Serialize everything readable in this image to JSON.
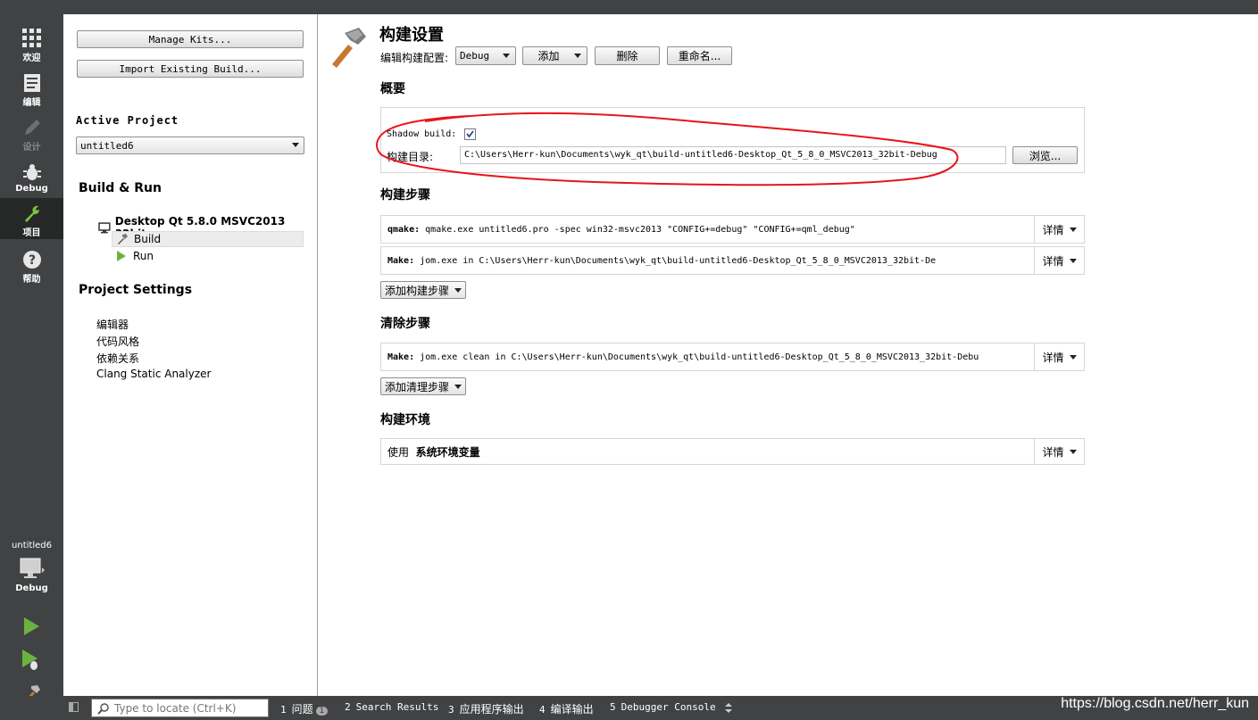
{
  "modebar": {
    "items": [
      {
        "label": "欢迎",
        "icon": "grid-icon"
      },
      {
        "label": "编辑",
        "icon": "document-icon"
      },
      {
        "label": "设计",
        "icon": "pencil-icon"
      },
      {
        "label": "Debug",
        "icon": "bug-icon"
      },
      {
        "label": "项目",
        "icon": "wrench-icon"
      },
      {
        "label": "帮助",
        "icon": "help-icon"
      }
    ],
    "active": "项目",
    "target_name": "untitled6",
    "target_mode": "Debug"
  },
  "sidebar": {
    "manage_kits": "Manage Kits...",
    "import_build": "Import Existing Build...",
    "active_project_label": "Active Project",
    "active_project_value": "untitled6",
    "build_run_heading": "Build & Run",
    "kit_name": "Desktop Qt 5.8.0 MSVC2013 32bit",
    "build_label": "Build",
    "run_label": "Run",
    "project_settings_heading": "Project Settings",
    "settings_items": [
      "编辑器",
      "代码风格",
      "依赖关系",
      "Clang Static Analyzer"
    ]
  },
  "main": {
    "title": "构建设置",
    "edit_config_label": "编辑构建配置:",
    "config_value": "Debug",
    "add_button": "添加",
    "delete_button": "删除",
    "rename_button": "重命名...",
    "general_heading": "概要",
    "shadow_build_label": "Shadow build:",
    "shadow_build_checked": true,
    "build_dir_label": "构建目录:",
    "build_dir_value": "C:\\Users\\Herr-kun\\Documents\\wyk_qt\\build-untitled6-Desktop_Qt_5_8_0_MSVC2013_32bit-Debug",
    "browse_button": "浏览...",
    "build_steps_heading": "构建步骤",
    "build_steps": [
      {
        "name": "qmake:",
        "text": "qmake.exe untitled6.pro -spec win32-msvc2013 \"CONFIG+=debug\" \"CONFIG+=qml_debug\""
      },
      {
        "name": "Make:",
        "text": "jom.exe in C:\\Users\\Herr-kun\\Documents\\wyk_qt\\build-untitled6-Desktop_Qt_5_8_0_MSVC2013_32bit-De"
      }
    ],
    "details_label": "详情",
    "add_build_step": "添加构建步骤",
    "clean_steps_heading": "清除步骤",
    "clean_step": {
      "name": "Make:",
      "text": "jom.exe clean in C:\\Users\\Herr-kun\\Documents\\wyk_qt\\build-untitled6-Desktop_Qt_5_8_0_MSVC2013_32bit-Debu"
    },
    "add_clean_step": "添加清理步骤",
    "build_env_heading": "构建环境",
    "env_use": "使用",
    "env_value": "系统环境变量"
  },
  "statusbar": {
    "locator_placeholder": "Type to locate (Ctrl+K)",
    "tabs": [
      {
        "num": "1",
        "label": "问题",
        "badge": "1"
      },
      {
        "num": "2",
        "label": "Search Results"
      },
      {
        "num": "3",
        "label": "应用程序输出"
      },
      {
        "num": "4",
        "label": "编译输出"
      },
      {
        "num": "5",
        "label": "Debugger Console"
      }
    ],
    "watermark": "https://blog.csdn.net/herr_kun"
  },
  "colors": {
    "modebar_bg": "#404244",
    "run_green": "#6cb33e",
    "annotation_red": "#e8141a"
  }
}
